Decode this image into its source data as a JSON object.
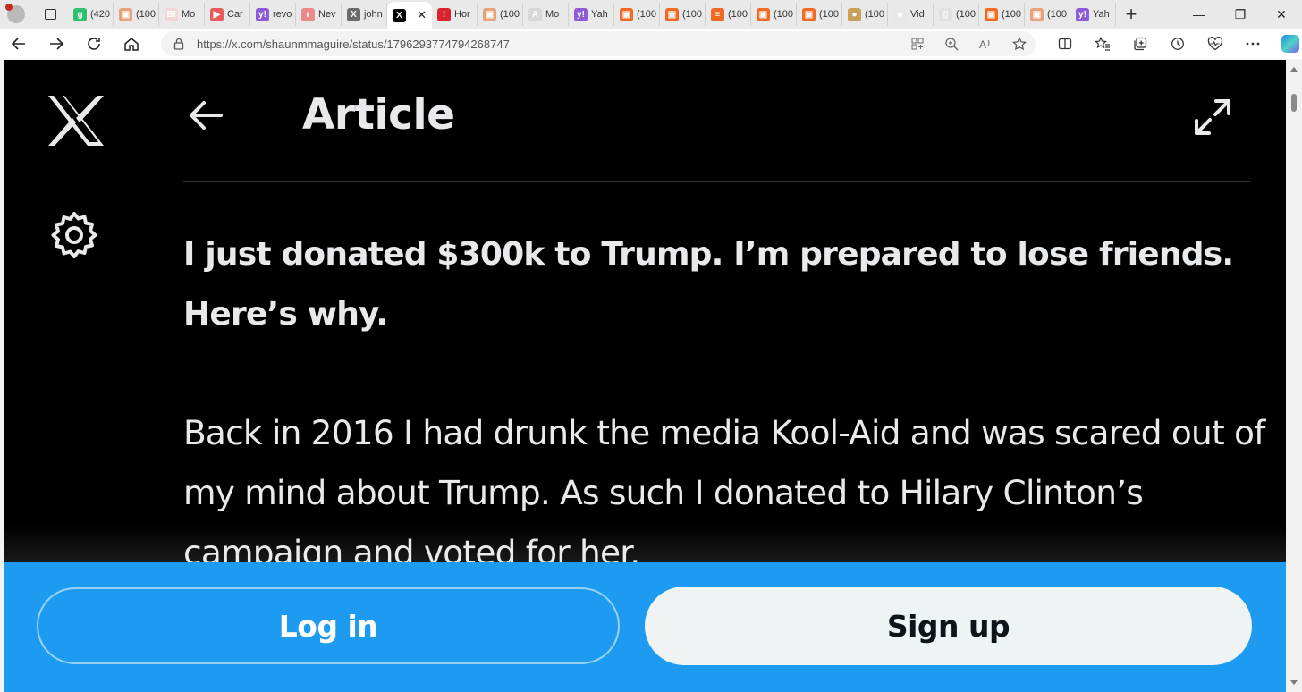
{
  "browser": {
    "tabs": [
      {
        "label": "(420",
        "fav_color": "#2fbf71",
        "glyph": "g"
      },
      {
        "label": "(100",
        "fav_color": "#e8a27a",
        "glyph": "▣"
      },
      {
        "label": "Mo",
        "fav_color": "#f3d6d6",
        "glyph": "BI"
      },
      {
        "label": "Car",
        "fav_color": "#e85c5c",
        "glyph": "▶"
      },
      {
        "label": "revo",
        "fav_color": "#8d5bd6",
        "glyph": "y!"
      },
      {
        "label": "Nev",
        "fav_color": "#e88a8a",
        "glyph": "r"
      },
      {
        "label": "john",
        "fav_color": "#6b6b6b",
        "glyph": "X"
      },
      {
        "label": "Hor",
        "fav_color": "#d9232e",
        "glyph": "!"
      },
      {
        "label": "(100",
        "fav_color": "#e8a27a",
        "glyph": "▣"
      },
      {
        "label": "Mo",
        "fav_color": "#d8d8d8",
        "glyph": "A"
      },
      {
        "label": "Yah",
        "fav_color": "#8d5bd6",
        "glyph": "y!"
      },
      {
        "label": "(100",
        "fav_color": "#f06a24",
        "glyph": "▣"
      },
      {
        "label": "(100",
        "fav_color": "#f06a24",
        "glyph": "▣"
      },
      {
        "label": "(100",
        "fav_color": "#f06a24",
        "glyph": "≡"
      },
      {
        "label": "(100",
        "fav_color": "#f06a24",
        "glyph": "▣"
      },
      {
        "label": "(100",
        "fav_color": "#f06a24",
        "glyph": "▣"
      },
      {
        "label": "(100",
        "fav_color": "#c9a15b",
        "glyph": "●"
      },
      {
        "label": "Vid",
        "fav_color": "#e7e7e7",
        "glyph": "★"
      },
      {
        "label": "(100",
        "fav_color": "#e0e0e0",
        "glyph": "▯"
      },
      {
        "label": "(100",
        "fav_color": "#f06a24",
        "glyph": "▣"
      },
      {
        "label": "(100",
        "fav_color": "#e8a27a",
        "glyph": "▣"
      },
      {
        "label": "Yah",
        "fav_color": "#8d5bd6",
        "glyph": "y!"
      }
    ],
    "active_tab_index": 7,
    "active_tab_fav_color": "#000000",
    "active_tab_glyph": "X",
    "active_tab_close": "✕",
    "new_tab_label": "+",
    "url": "https://x.com/shaunmmaguire/status/1796293774794268747"
  },
  "page": {
    "header_title": "Article",
    "headline": "I just donated $300k to Trump. I’m prepared to lose friends. Here’s why.",
    "body": "Back in 2016 I had drunk the media Kool-Aid and was scared out of my mind about Trump. As such I donated to Hilary Clinton’s campaign and voted for her.",
    "login_label": "Log in",
    "signup_label": "Sign up"
  },
  "colors": {
    "accent": "#1d9bf0",
    "background": "#000000",
    "text": "#e7e9ea",
    "signup_bg": "#eff3f4"
  }
}
